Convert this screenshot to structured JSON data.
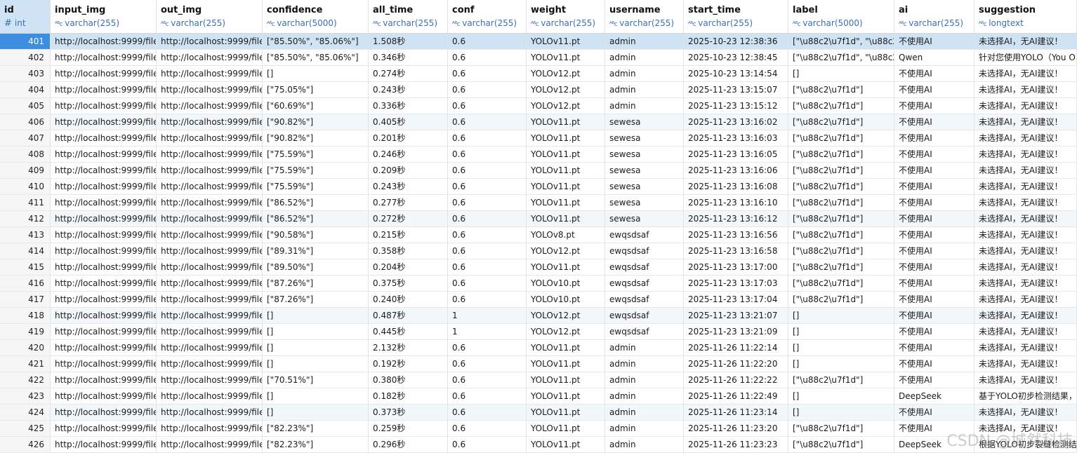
{
  "columns": [
    {
      "name": "id",
      "type": "int",
      "type_icon": "#"
    },
    {
      "name": "input_img",
      "type": "varchar(255)",
      "type_icon": "ABC"
    },
    {
      "name": "out_img",
      "type": "varchar(255)",
      "type_icon": "ABC"
    },
    {
      "name": "confidence",
      "type": "varchar(5000)",
      "type_icon": "ABC"
    },
    {
      "name": "all_time",
      "type": "varchar(255)",
      "type_icon": "ABC"
    },
    {
      "name": "conf",
      "type": "varchar(255)",
      "type_icon": "ABC"
    },
    {
      "name": "weight",
      "type": "varchar(255)",
      "type_icon": "ABC"
    },
    {
      "name": "username",
      "type": "varchar(255)",
      "type_icon": "ABC"
    },
    {
      "name": "start_time",
      "type": "varchar(255)",
      "type_icon": "ABC"
    },
    {
      "name": "label",
      "type": "varchar(5000)",
      "type_icon": "ABC"
    },
    {
      "name": "ai",
      "type": "varchar(255)",
      "type_icon": "ABC"
    },
    {
      "name": "suggestion",
      "type": "longtext",
      "type_icon": "ABC"
    }
  ],
  "rows": [
    [
      "401",
      "http://localhost:9999/file",
      "http://localhost:9999/file",
      "[\"85.50%\", \"85.06%\"]",
      "1.508秒",
      "0.6",
      "YOLOv11.pt",
      "admin",
      "2025-10-23 12:38:36",
      "[\"\\u88c2\\u7f1d\", \"\\u88c2",
      "不使用AI",
      "未选择AI，无AI建议！"
    ],
    [
      "402",
      "http://localhost:9999/file",
      "http://localhost:9999/file",
      "[\"85.50%\", \"85.06%\"]",
      "0.346秒",
      "0.6",
      "YOLOv11.pt",
      "admin",
      "2025-10-23 12:38:45",
      "[\"\\u88c2\\u7f1d\", \"\\u88c2",
      "Qwen",
      "针对您使用YOLO（You O"
    ],
    [
      "403",
      "http://localhost:9999/file",
      "http://localhost:9999/file",
      "[]",
      "0.274秒",
      "0.6",
      "YOLOv12.pt",
      "admin",
      "2025-10-23 13:14:54",
      "[]",
      "不使用AI",
      "未选择AI，无AI建议！"
    ],
    [
      "404",
      "http://localhost:9999/file",
      "http://localhost:9999/file",
      "[\"75.05%\"]",
      "0.243秒",
      "0.6",
      "YOLOv12.pt",
      "admin",
      "2025-11-23 13:15:07",
      "[\"\\u88c2\\u7f1d\"]",
      "不使用AI",
      "未选择AI，无AI建议！"
    ],
    [
      "405",
      "http://localhost:9999/file",
      "http://localhost:9999/file",
      "[\"60.69%\"]",
      "0.336秒",
      "0.6",
      "YOLOv12.pt",
      "admin",
      "2025-11-23 13:15:12",
      "[\"\\u88c2\\u7f1d\"]",
      "不使用AI",
      "未选择AI，无AI建议！"
    ],
    [
      "406",
      "http://localhost:9999/file",
      "http://localhost:9999/file",
      "[\"90.82%\"]",
      "0.405秒",
      "0.6",
      "YOLOv11.pt",
      "sewesa",
      "2025-11-23 13:16:02",
      "[\"\\u88c2\\u7f1d\"]",
      "不使用AI",
      "未选择AI，无AI建议！"
    ],
    [
      "407",
      "http://localhost:9999/file",
      "http://localhost:9999/file",
      "[\"90.82%\"]",
      "0.201秒",
      "0.6",
      "YOLOv11.pt",
      "sewesa",
      "2025-11-23 13:16:03",
      "[\"\\u88c2\\u7f1d\"]",
      "不使用AI",
      "未选择AI，无AI建议！"
    ],
    [
      "408",
      "http://localhost:9999/file",
      "http://localhost:9999/file",
      "[\"75.59%\"]",
      "0.246秒",
      "0.6",
      "YOLOv11.pt",
      "sewesa",
      "2025-11-23 13:16:05",
      "[\"\\u88c2\\u7f1d\"]",
      "不使用AI",
      "未选择AI，无AI建议！"
    ],
    [
      "409",
      "http://localhost:9999/file",
      "http://localhost:9999/file",
      "[\"75.59%\"]",
      "0.209秒",
      "0.6",
      "YOLOv11.pt",
      "sewesa",
      "2025-11-23 13:16:06",
      "[\"\\u88c2\\u7f1d\"]",
      "不使用AI",
      "未选择AI，无AI建议！"
    ],
    [
      "410",
      "http://localhost:9999/file",
      "http://localhost:9999/file",
      "[\"75.59%\"]",
      "0.243秒",
      "0.6",
      "YOLOv11.pt",
      "sewesa",
      "2025-11-23 13:16:08",
      "[\"\\u88c2\\u7f1d\"]",
      "不使用AI",
      "未选择AI，无AI建议！"
    ],
    [
      "411",
      "http://localhost:9999/file",
      "http://localhost:9999/file",
      "[\"86.52%\"]",
      "0.277秒",
      "0.6",
      "YOLOv11.pt",
      "sewesa",
      "2025-11-23 13:16:10",
      "[\"\\u88c2\\u7f1d\"]",
      "不使用AI",
      "未选择AI，无AI建议！"
    ],
    [
      "412",
      "http://localhost:9999/file",
      "http://localhost:9999/file",
      "[\"86.52%\"]",
      "0.272秒",
      "0.6",
      "YOLOv11.pt",
      "sewesa",
      "2025-11-23 13:16:12",
      "[\"\\u88c2\\u7f1d\"]",
      "不使用AI",
      "未选择AI，无AI建议！"
    ],
    [
      "413",
      "http://localhost:9999/file",
      "http://localhost:9999/file",
      "[\"90.58%\"]",
      "0.215秒",
      "0.6",
      "YOLOv8.pt",
      "ewqsdsaf",
      "2025-11-23 13:16:56",
      "[\"\\u88c2\\u7f1d\"]",
      "不使用AI",
      "未选择AI，无AI建议！"
    ],
    [
      "414",
      "http://localhost:9999/file",
      "http://localhost:9999/file",
      "[\"89.31%\"]",
      "0.358秒",
      "0.6",
      "YOLOv12.pt",
      "ewqsdsaf",
      "2025-11-23 13:16:58",
      "[\"\\u88c2\\u7f1d\"]",
      "不使用AI",
      "未选择AI，无AI建议！"
    ],
    [
      "415",
      "http://localhost:9999/file",
      "http://localhost:9999/file",
      "[\"89.50%\"]",
      "0.204秒",
      "0.6",
      "YOLOv11.pt",
      "ewqsdsaf",
      "2025-11-23 13:17:00",
      "[\"\\u88c2\\u7f1d\"]",
      "不使用AI",
      "未选择AI，无AI建议！"
    ],
    [
      "416",
      "http://localhost:9999/file",
      "http://localhost:9999/file",
      "[\"87.26%\"]",
      "0.375秒",
      "0.6",
      "YOLOv10.pt",
      "ewqsdsaf",
      "2025-11-23 13:17:03",
      "[\"\\u88c2\\u7f1d\"]",
      "不使用AI",
      "未选择AI，无AI建议！"
    ],
    [
      "417",
      "http://localhost:9999/file",
      "http://localhost:9999/file",
      "[\"87.26%\"]",
      "0.240秒",
      "0.6",
      "YOLOv10.pt",
      "ewqsdsaf",
      "2025-11-23 13:17:04",
      "[\"\\u88c2\\u7f1d\"]",
      "不使用AI",
      "未选择AI，无AI建议！"
    ],
    [
      "418",
      "http://localhost:9999/file",
      "http://localhost:9999/file",
      "[]",
      "0.487秒",
      "1",
      "YOLOv12.pt",
      "ewqsdsaf",
      "2025-11-23 13:21:07",
      "[]",
      "不使用AI",
      "未选择AI，无AI建议！"
    ],
    [
      "419",
      "http://localhost:9999/file",
      "http://localhost:9999/file",
      "[]",
      "0.445秒",
      "1",
      "YOLOv12.pt",
      "ewqsdsaf",
      "2025-11-23 13:21:09",
      "[]",
      "不使用AI",
      "未选择AI，无AI建议！"
    ],
    [
      "420",
      "http://localhost:9999/file",
      "http://localhost:9999/file",
      "[]",
      "2.132秒",
      "0.6",
      "YOLOv11.pt",
      "admin",
      "2025-11-26 11:22:14",
      "[]",
      "不使用AI",
      "未选择AI，无AI建议！"
    ],
    [
      "421",
      "http://localhost:9999/file",
      "http://localhost:9999/file",
      "[]",
      "0.192秒",
      "0.6",
      "YOLOv11.pt",
      "admin",
      "2025-11-26 11:22:20",
      "[]",
      "不使用AI",
      "未选择AI，无AI建议！"
    ],
    [
      "422",
      "http://localhost:9999/file",
      "http://localhost:9999/file",
      "[\"70.51%\"]",
      "0.380秒",
      "0.6",
      "YOLOv11.pt",
      "admin",
      "2025-11-26 11:22:22",
      "[\"\\u88c2\\u7f1d\"]",
      "不使用AI",
      "未选择AI，无AI建议！"
    ],
    [
      "423",
      "http://localhost:9999/file",
      "http://localhost:9999/file",
      "[]",
      "0.182秒",
      "0.6",
      "YOLOv11.pt",
      "admin",
      "2025-11-26 11:22:49",
      "[]",
      "DeepSeek",
      "基于YOLO初步检测结果，"
    ],
    [
      "424",
      "http://localhost:9999/file",
      "http://localhost:9999/file",
      "[]",
      "0.373秒",
      "0.6",
      "YOLOv11.pt",
      "admin",
      "2025-11-26 11:23:14",
      "[]",
      "不使用AI",
      "未选择AI，无AI建议！"
    ],
    [
      "425",
      "http://localhost:9999/file",
      "http://localhost:9999/file",
      "[\"82.23%\"]",
      "0.259秒",
      "0.6",
      "YOLOv11.pt",
      "admin",
      "2025-11-26 11:23:20",
      "[\"\\u88c2\\u7f1d\"]",
      "不使用AI",
      "未选择AI，无AI建议！"
    ],
    [
      "426",
      "http://localhost:9999/file",
      "http://localhost:9999/file",
      "[\"82.23%\"]",
      "0.296秒",
      "0.6",
      "YOLOv11.pt",
      "admin",
      "2025-11-26 11:23:23",
      "[\"\\u88c2\\u7f1d\"]",
      "DeepSeek",
      "根据YOLO初步裂缝检测结"
    ]
  ],
  "alt_rows": [
    "406",
    "412",
    "418",
    "424"
  ],
  "selected_row": "401",
  "watermark": "CSDN @城然科技",
  "colors": {
    "selected_row": "#cfe3f4",
    "selected_id": "#3d8ee0",
    "alt_row": "#f2f7fc",
    "type_text": "#3a6fb5"
  }
}
